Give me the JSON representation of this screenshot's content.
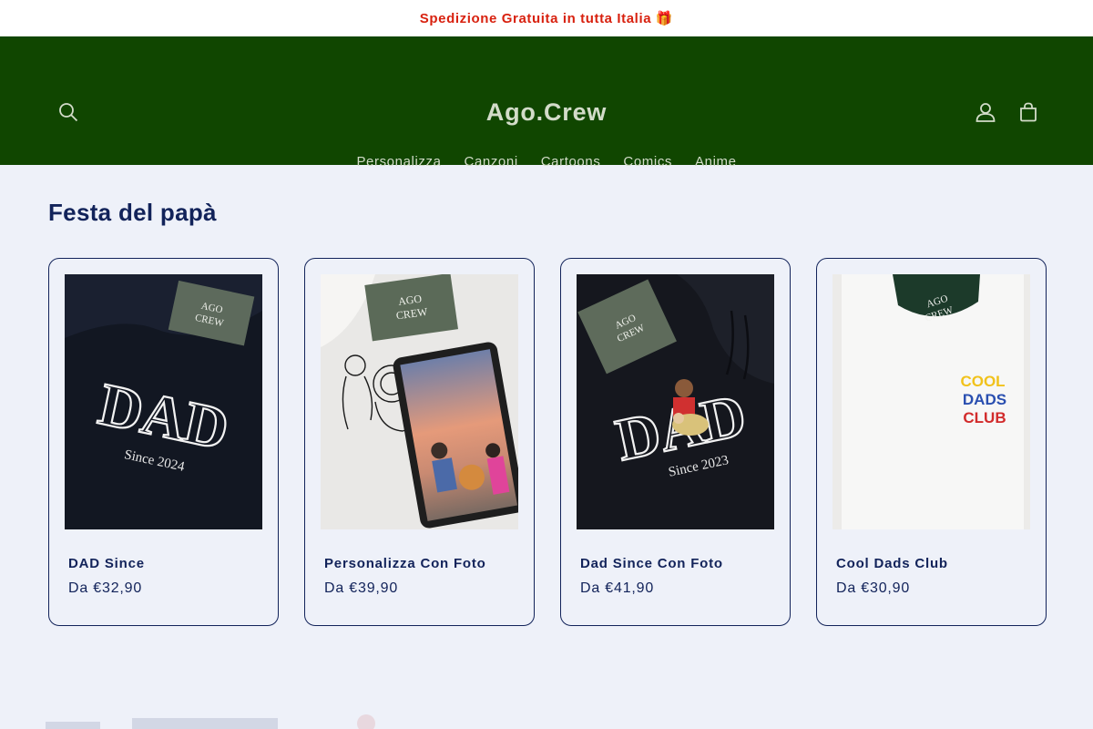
{
  "announcement": {
    "text": "Spedizione Gratuita in tutta Italia 🎁",
    "color": "#d8210f"
  },
  "header": {
    "logo": "Ago.Crew",
    "background": "#104600",
    "nav": [
      "Personalizza",
      "Canzoni",
      "Cartoons",
      "Comics",
      "Anime"
    ],
    "icons": [
      "search-icon",
      "account-icon",
      "cart-icon"
    ]
  },
  "section": {
    "title": "Festa del papà",
    "products": [
      {
        "name": "DAD Since",
        "price": "Da €32,90",
        "image_text": [
          "AGO",
          "CREW",
          "DAD",
          "Since 2024"
        ]
      },
      {
        "name": "Personalizza Con Foto",
        "price": "Da €39,90",
        "image_text": [
          "AGO",
          "CREW"
        ]
      },
      {
        "name": "Dad Since Con Foto",
        "price": "Da €41,90",
        "image_text": [
          "AGO",
          "CREW",
          "DAD",
          "Since 2023"
        ]
      },
      {
        "name": "Cool Dads Club",
        "price": "Da €30,90",
        "image_text": [
          "AGO",
          "CREW",
          "COOL",
          "DADS",
          "CLUB"
        ]
      }
    ]
  },
  "colors": {
    "page_bg": "#eef1f9",
    "text": "#12235a",
    "nav_text": "#d3dcc9"
  }
}
